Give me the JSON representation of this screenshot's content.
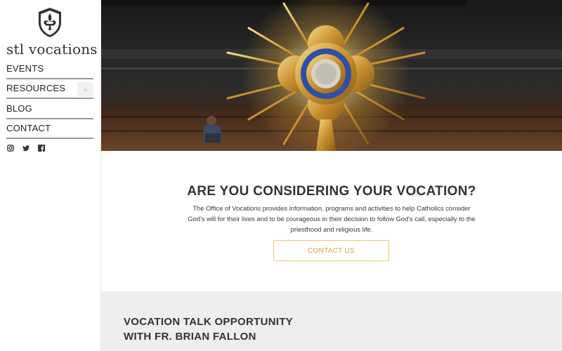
{
  "brand": {
    "name": "stl vocations",
    "logo_icon": "fleur-de-lis-shield-icon"
  },
  "nav": {
    "items": [
      {
        "label": "EVENTS"
      },
      {
        "label": "RESOURCES",
        "expand": "+"
      },
      {
        "label": "BLOG"
      },
      {
        "label": "CONTACT"
      }
    ]
  },
  "social": [
    "instagram-icon",
    "twitter-icon",
    "facebook-icon"
  ],
  "hero": {
    "image": "monstrance-with-kneeling-person"
  },
  "intro": {
    "title": "ARE YOU CONSIDERING YOUR VOCATION?",
    "body": "The Office of Vocations provides information, programs and activities to help Catholics consider God's will for their lives and to be courageous in their decision to follow God's call, especially to the priesthood and religious life.",
    "cta": "CONTACT US"
  },
  "feature": {
    "line1": "VOCATION TALK OPPORTUNITY",
    "line2": "WITH FR. BRIAN FALLON"
  },
  "colors": {
    "accent": "#d6a83a",
    "accent_border": "#e5c970",
    "text_dark": "#2f3437",
    "band_bg": "#eeeeee"
  }
}
